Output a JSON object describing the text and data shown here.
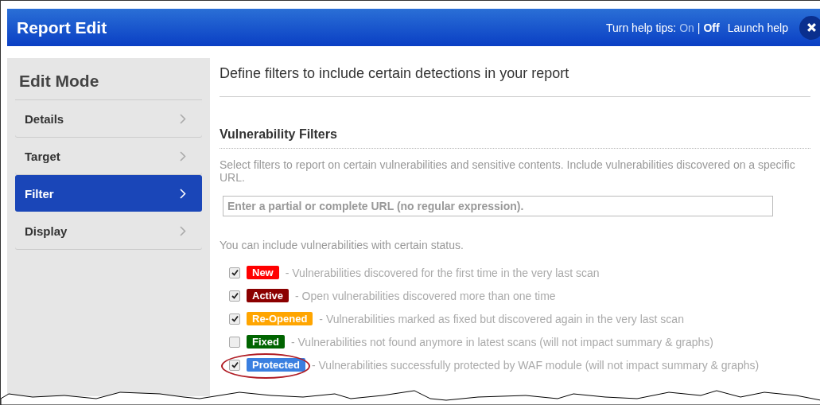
{
  "window": {
    "title": "Report Edit"
  },
  "help": {
    "label": "Turn help tips:",
    "on": "On",
    "separator": "|",
    "off": "Off",
    "tips_on": false,
    "launch": "Launch help"
  },
  "sidebar": {
    "title": "Edit Mode",
    "items": [
      {
        "label": "Details",
        "selected": false
      },
      {
        "label": "Target",
        "selected": false
      },
      {
        "label": "Filter",
        "selected": true
      },
      {
        "label": "Display",
        "selected": false
      }
    ]
  },
  "main": {
    "heading": "Define filters to include certain detections in your report",
    "section_title": "Vulnerability Filters",
    "intro": "Select filters to report on certain vulnerabilities and sensitive contents. Include vulnerabilities discovered on a specific URL.",
    "url_field": {
      "placeholder": "Enter a partial or complete URL (no regular expression)."
    },
    "status_intro": "You can include vulnerabilities with certain status.",
    "statuses": [
      {
        "tag": "New",
        "color": "#ff0000",
        "checked": true,
        "highlighted": false,
        "description": "- Vulnerabilities discovered for the first time in the very last scan"
      },
      {
        "tag": "Active",
        "color": "#8b0000",
        "checked": true,
        "highlighted": false,
        "description": "- Open vulnerabilities discovered more than one time"
      },
      {
        "tag": "Re-Opened",
        "color": "#ffa500",
        "checked": true,
        "highlighted": false,
        "description": "- Vulnerabilities marked as fixed but discovered again in the very last scan"
      },
      {
        "tag": "Fixed",
        "color": "#006400",
        "checked": false,
        "highlighted": false,
        "description": "- Vulnerabilities not found anymore in latest scans (will not impact summary & graphs)"
      },
      {
        "tag": "Protected",
        "color": "#3a7fe0",
        "checked": true,
        "highlighted": true,
        "description": "- Vulnerabilities successfully protected by WAF module (will not impact summary & graphs)"
      }
    ]
  }
}
